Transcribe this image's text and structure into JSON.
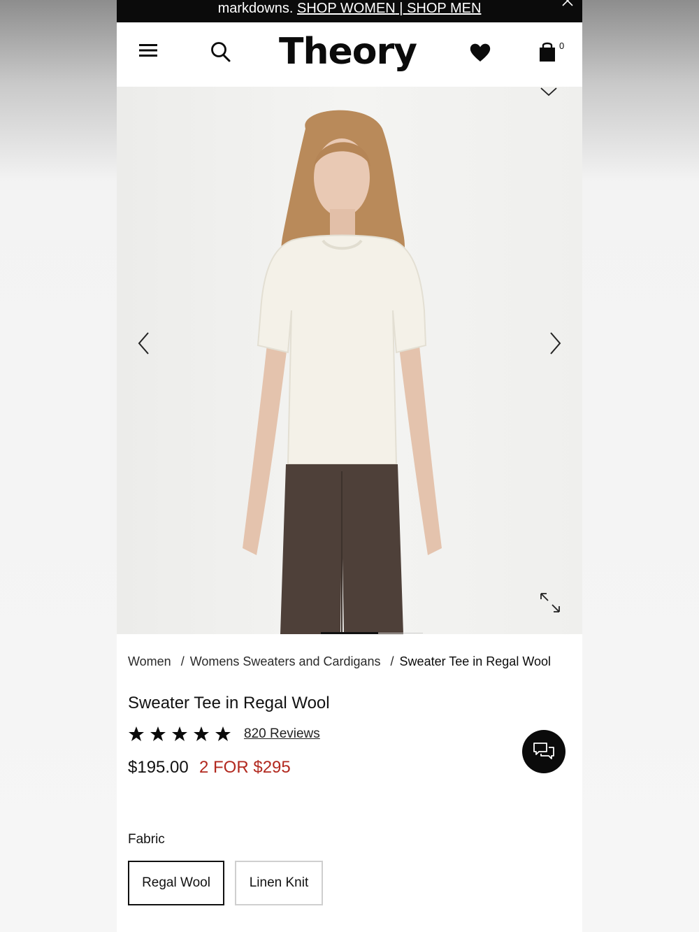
{
  "promo": {
    "text": "markdowns. ",
    "shop_women": "SHOP WOMEN",
    "divider": " | ",
    "shop_men": "SHOP MEN"
  },
  "header": {
    "logo": "Theory",
    "bag_count": "0",
    "icons": [
      "menu-icon",
      "search-icon",
      "heart-icon",
      "shopping-bag-icon"
    ]
  },
  "gallery": {
    "icons": [
      "chevron-down-icon",
      "chevron-left-icon",
      "chevron-right-icon",
      "expand-icon"
    ],
    "current_slide": 1
  },
  "breadcrumb": {
    "items": [
      "Women",
      "Womens Sweaters and Cardigans",
      "Sweater Tee in Regal Wool"
    ],
    "separator": "/"
  },
  "product": {
    "title": "Sweater Tee in Regal Wool",
    "rating_stars": 5,
    "reviews": "820 Reviews",
    "price": "$195.00",
    "promo_price": "2 FOR $295"
  },
  "fabric": {
    "label": "Fabric",
    "options": [
      "Regal Wool",
      "Linen Knit"
    ],
    "selected": "Regal Wool"
  },
  "colors": {
    "promo_price": "#b2291f",
    "brand_black": "#0b0b0b"
  }
}
